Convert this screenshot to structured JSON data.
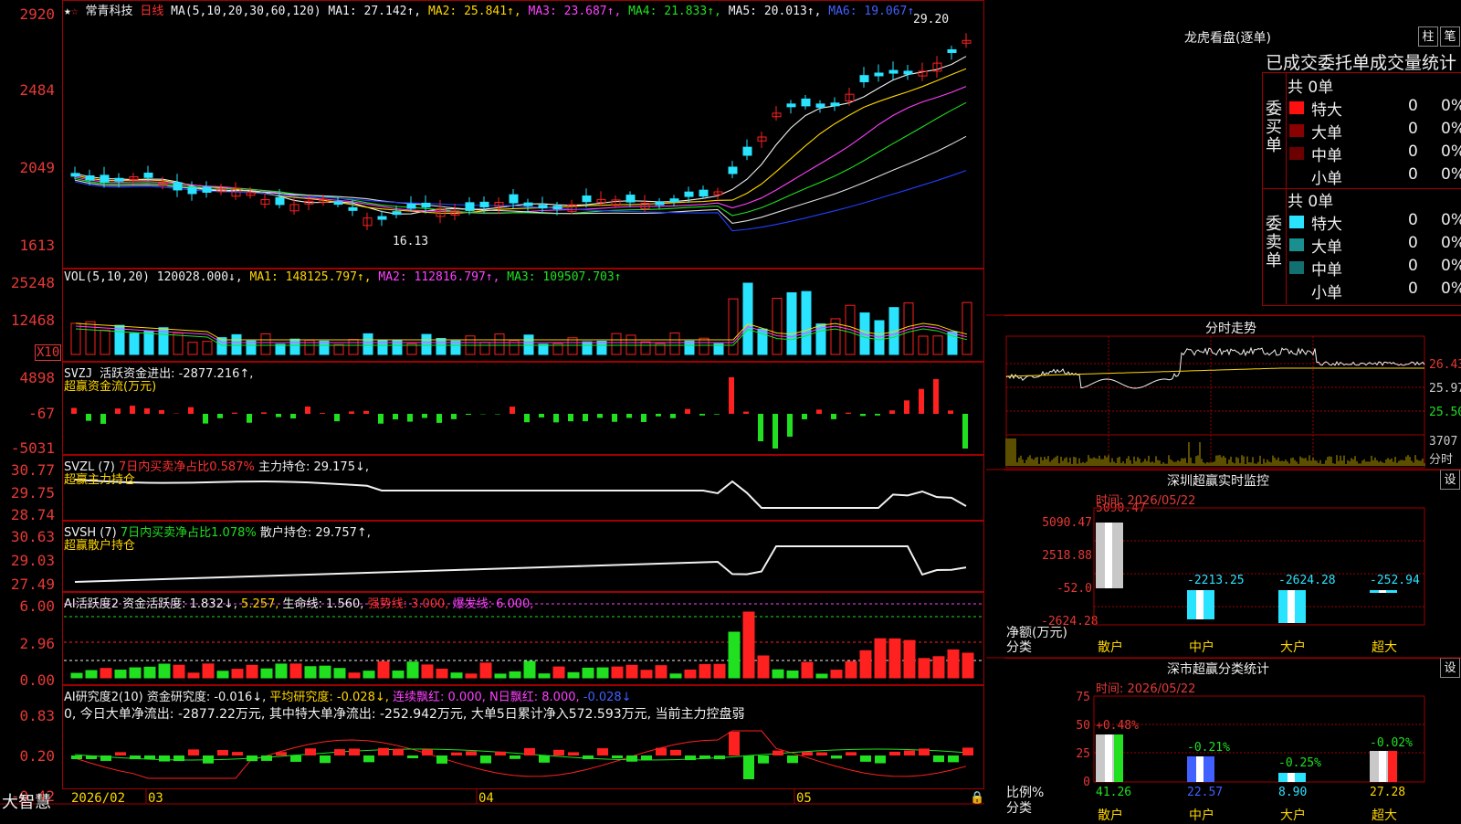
{
  "stock": {
    "name": "常青科技",
    "period": "日线"
  },
  "ma_header": {
    "label": "MA(5,10,20,30,60,120)",
    "ma1": "MA1: 27.142↑,",
    "ma2": "MA2: 25.841↑,",
    "ma3": "MA3: 23.687↑,",
    "ma4": "MA4: 21.833↑,",
    "ma5": "MA5: 20.013↑,",
    "ma6": "MA6: 19.067↑"
  },
  "price_axis": [
    "2920",
    "2484",
    "2049",
    "1613"
  ],
  "price_annotations": {
    "high": "29.20",
    "low": "16.13"
  },
  "vol_header": {
    "label": "VOL(5,10,20)",
    "value": "120028.000↓,",
    "ma1": "MA1: 148125.797↑,",
    "ma2": "MA2: 112816.797↑,",
    "ma3": "MA3: 109507.703↑"
  },
  "vol_axis": [
    "25248",
    "12468"
  ],
  "vol_unit": "X10",
  "svzj": {
    "label": "SVZJ",
    "text": "活跃资金进出: -2877.216↑,",
    "sub": "超赢资金流(万元)",
    "axis": [
      "4898",
      "-67",
      "-5031"
    ]
  },
  "svzl": {
    "label": "SVZL (7)",
    "ratio": "7日内买卖净占比0.587%",
    "hold": "主力持仓: 29.175↓,",
    "sub": "超赢主力持仓",
    "axis": [
      "30.77",
      "29.75",
      "28.74"
    ]
  },
  "svsh": {
    "label": "SVSH (7)",
    "ratio": "7日内买卖净占比1.078%",
    "hold": "散户持仓: 29.757↑,",
    "sub": "超赢散户持仓",
    "axis": [
      "30.63",
      "29.03",
      "27.49"
    ]
  },
  "ai_act": {
    "label": "AI活跃度2",
    "fund": "资金活跃度: 1.832↓,",
    "v2": "5.257,",
    "life": "生命线: 1.560,",
    "strong": "强势线: 3.000,",
    "burst": "爆发线: 6.000,",
    "axis": [
      "6.00",
      "2.96",
      "0.00"
    ]
  },
  "ai_res": {
    "label": "AI研究度2(10)",
    "fund": "资金研究度: -0.016↓,",
    "avg": "平均研究度: -0.028↓,",
    "red": "连续飘红: 0.000,",
    "nred": "N日飘红: 8.000,",
    "last": "-0.028↓",
    "summary": "0, 今日大单净流出: -2877.22万元, 其中特大单净流出: -252.942万元, 大单5日累计净入572.593万元, 当前主力控盘弱",
    "axis": [
      "0.83",
      "0.20",
      "-0.42"
    ]
  },
  "bottom_bar": {
    "brand": "大智慧",
    "dates": [
      "2026/02",
      "03",
      "04",
      "05"
    ]
  },
  "longhu": {
    "title": "龙虎看盘(逐单)",
    "btn1": "柱",
    "btn2": "笔",
    "subtitle": "已成交委托单成交量统计",
    "buy_label": "委买单",
    "sell_label": "委卖单",
    "buy_total": "共 0单",
    "sell_total": "共 0单",
    "buy_rows": [
      {
        "name": "特大",
        "count": "0",
        "pct": "0%",
        "color": "#ff1010"
      },
      {
        "name": "大单",
        "count": "0",
        "pct": "0%",
        "color": "#8b0000"
      },
      {
        "name": "中单",
        "count": "0",
        "pct": "0%",
        "color": "#6b0000"
      },
      {
        "name": "小单",
        "count": "0",
        "pct": "0%",
        "color": "#000000"
      }
    ],
    "sell_rows": [
      {
        "name": "特大",
        "count": "0",
        "pct": "0%",
        "color": "#29e3ff"
      },
      {
        "name": "大单",
        "count": "0",
        "pct": "0%",
        "color": "#1a8f8f"
      },
      {
        "name": "中单",
        "count": "0",
        "pct": "0%",
        "color": "#127070"
      },
      {
        "name": "小单",
        "count": "0",
        "pct": "0%",
        "color": "#000000"
      }
    ]
  },
  "intraday": {
    "title": "分时走势",
    "axis": [
      "26.43",
      "25.97",
      "25.50"
    ],
    "vol_label": "3707",
    "vol_sub": "分时"
  },
  "monitor": {
    "title": "深圳超赢实时监控",
    "btn": "设",
    "time": "时间: 2026/05/22",
    "axis": [
      "5090.47",
      "2518.88",
      "-52.0",
      "-2624.28"
    ],
    "ylabel": "净额(万元)",
    "xlabel": "分类",
    "cats": [
      "散户",
      "中户",
      "大户",
      "超大"
    ],
    "values": [
      "5090.47",
      "-2213.25",
      "-2624.28",
      "-252.94"
    ]
  },
  "classstat": {
    "title": "深市超赢分类统计",
    "btn": "设",
    "time": "时间: 2026/05/22",
    "axis": [
      "75",
      "50",
      "25",
      "0"
    ],
    "ylabel": "比例%",
    "xlabel": "分类",
    "cats": [
      "散户",
      "中户",
      "大户",
      "超大"
    ],
    "top_labels": [
      "+0.48%",
      "-0.21%",
      "-0.25%",
      "-0.02%"
    ],
    "bottom_labels": [
      "41.26",
      "22.57",
      "8.90",
      "27.28"
    ]
  }
}
